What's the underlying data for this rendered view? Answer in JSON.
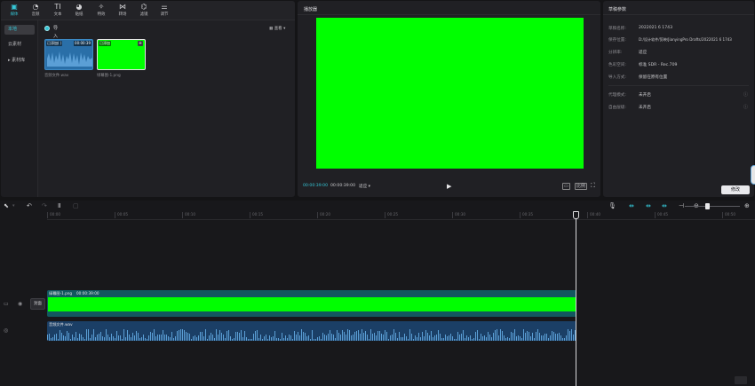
{
  "colors": {
    "accent": "#35c6d6",
    "chroma_green": "#00ff00",
    "panel_bg": "#202024",
    "app_bg": "#141416",
    "audio_clip": "#1b3f66",
    "video_clip": "#12585f"
  },
  "toolbar_tabs": [
    {
      "label": "媒体",
      "icon": "media-icon"
    },
    {
      "label": "音频",
      "icon": "audio-icon"
    },
    {
      "label": "文本",
      "icon": "text-icon"
    },
    {
      "label": "贴纸",
      "icon": "sticker-icon"
    },
    {
      "label": "特效",
      "icon": "effects-icon"
    },
    {
      "label": "转场",
      "icon": "transition-icon"
    },
    {
      "label": "滤镜",
      "icon": "filter-icon"
    },
    {
      "label": "调节",
      "icon": "adjust-icon"
    }
  ],
  "media_sidebar": [
    {
      "label": "本地",
      "active": true
    },
    {
      "label": "云素材",
      "active": false
    },
    {
      "label": "▸ 素材库",
      "active": false
    }
  ],
  "media": {
    "import_label": "导入",
    "sort_label": "查看 ▾",
    "items": [
      {
        "name": "音频文件.wav",
        "badge": "已添加",
        "badge_extra": "(  )",
        "duration": "00:00:39",
        "kind": "audio"
      },
      {
        "name": "绿幕图-1.png",
        "badge": "已添加",
        "kind": "image"
      }
    ]
  },
  "player": {
    "title": "播放器",
    "current_time": "00:00:39:00",
    "total_time": "00:00:39:00",
    "ratio_label": "适应 ▾",
    "play_icon": "play-icon",
    "btn_a": "▭",
    "btn_b": "比例"
  },
  "properties": {
    "title": "草稿参数",
    "rows": [
      {
        "key": "草稿名称:",
        "value": "2022021 6 1743"
      },
      {
        "key": "保存位置:",
        "value": "D:/设计软件/剪映/JianyingPro Drafts/2022021 6 1743"
      },
      {
        "key": "分辨率:",
        "value": "适应"
      },
      {
        "key": "色彩空间:",
        "value": "标准 SDR - Rec.709"
      },
      {
        "key": "导入方式:",
        "value": "保留在原有位置"
      },
      {
        "key": "代理模式:",
        "value": "未开启"
      },
      {
        "key": "自由层级:",
        "value": "未开启"
      }
    ],
    "edit_button": "修改"
  },
  "timeline": {
    "ruler": [
      "00:00",
      "00:05",
      "00:10",
      "00:15",
      "00:20",
      "00:25",
      "00:30",
      "00:35",
      "00:40",
      "00:45",
      "00:50"
    ],
    "cover_label": "封面",
    "video_clip": {
      "name": "绿幕图-1.png",
      "duration": "00:00:39:00"
    },
    "audio_clip": {
      "name": "音频文件.wav"
    }
  }
}
